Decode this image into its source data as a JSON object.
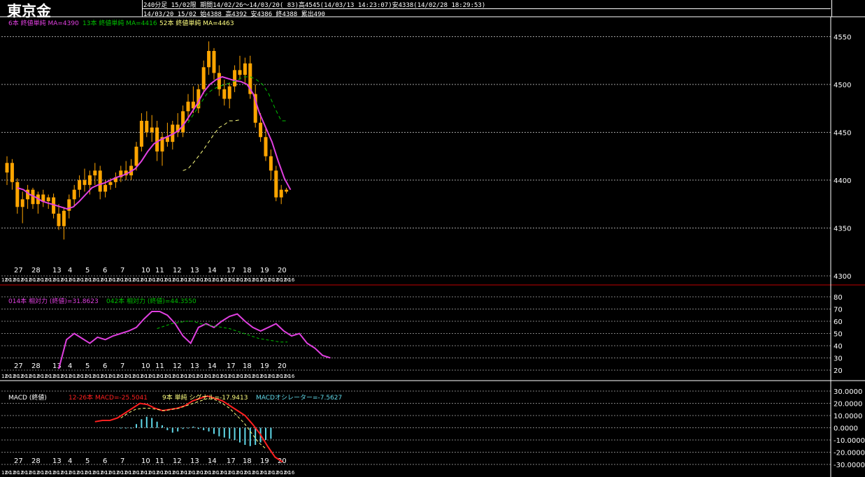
{
  "header": {
    "title": "東京金",
    "row1_a": "240分足 15/02限",
    "row1_b": "期間14/02/26〜14/03/20( 83)高4545(14/03/13 14:23:07)安4338(14/02/28 18:29:53)",
    "row2": "14/03/20 15/02 始4388 高4392 安4386 終4388 累出490"
  },
  "colors": {
    "background": "#000000",
    "candle": "#ffa500",
    "ma6": "#e040e0",
    "ma13": "#00c000",
    "ma52": "#ffff80",
    "rsi14": "#e040e0",
    "rsi42": "#00c000",
    "macd": "#ff2020",
    "signal": "#ffff80",
    "osc": "#60d8e8",
    "divider": "#c00000",
    "grid": "#ffffff"
  },
  "x_date_labels": [
    "27",
    "28",
    "13",
    "4",
    "5",
    "6",
    "7",
    "10",
    "11",
    "12",
    "13",
    "14",
    "17",
    "18",
    "19",
    "20"
  ],
  "x_time_labels": [
    "12",
    "00",
    "12",
    "00",
    "12",
    "00",
    "12",
    "00",
    "12",
    "00",
    "12",
    "00",
    "12",
    "00",
    "12",
    "00",
    "12",
    "00",
    "12",
    "00",
    "12",
    "00",
    "12",
    "00",
    "12",
    "00",
    "12",
    "00",
    "12",
    "00",
    "12",
    "00",
    "12",
    "00",
    "12",
    "00",
    "12",
    "00",
    "12",
    "00",
    "12",
    "00",
    "12",
    "00",
    "12",
    "00",
    "12",
    "00",
    "12",
    "00",
    "12",
    "00",
    "12",
    "00",
    "12",
    "00",
    "12",
    "00",
    "12",
    "00",
    "12",
    "00",
    "12",
    "00",
    "12",
    "00",
    "12",
    "00",
    "12",
    "00",
    "12",
    "00",
    "16"
  ],
  "chart_data": [
    {
      "type": "candlestick",
      "panel": "price",
      "legend": {
        "ma6": "6本 終値単純 MA=4390",
        "ma13": "13本 終値単純 MA=4416",
        "ma52": "52本 終値単純 MA=4463"
      },
      "ylim": [
        4300,
        4570
      ],
      "yticks": [
        4300,
        4350,
        4400,
        4450,
        4500,
        4550
      ],
      "ohlc": [
        [
          4408,
          4425,
          4395,
          4418
        ],
        [
          4418,
          4422,
          4390,
          4398
        ],
        [
          4398,
          4402,
          4365,
          4372
        ],
        [
          4372,
          4388,
          4355,
          4380
        ],
        [
          4380,
          4395,
          4370,
          4390
        ],
        [
          4390,
          4392,
          4370,
          4375
        ],
        [
          4375,
          4388,
          4365,
          4385
        ],
        [
          4385,
          4390,
          4372,
          4378
        ],
        [
          4378,
          4385,
          4370,
          4382
        ],
        [
          4382,
          4386,
          4360,
          4365
        ],
        [
          4365,
          4375,
          4348,
          4352
        ],
        [
          4352,
          4372,
          4338,
          4368
        ],
        [
          4368,
          4385,
          4360,
          4380
        ],
        [
          4380,
          4395,
          4372,
          4390
        ],
        [
          4390,
          4405,
          4382,
          4400
        ],
        [
          4400,
          4412,
          4388,
          4395
        ],
        [
          4395,
          4410,
          4385,
          4405
        ],
        [
          4405,
          4418,
          4395,
          4410
        ],
        [
          4410,
          4415,
          4380,
          4388
        ],
        [
          4388,
          4400,
          4382,
          4395
        ],
        [
          4395,
          4402,
          4390,
          4398
        ],
        [
          4398,
          4408,
          4392,
          4403
        ],
        [
          4403,
          4415,
          4398,
          4410
        ],
        [
          4410,
          4420,
          4400,
          4405
        ],
        [
          4405,
          4422,
          4400,
          4415
        ],
        [
          4415,
          4440,
          4410,
          4435
        ],
        [
          4435,
          4470,
          4430,
          4462
        ],
        [
          4462,
          4472,
          4445,
          4450
        ],
        [
          4450,
          4468,
          4440,
          4455
        ],
        [
          4455,
          4462,
          4420,
          4430
        ],
        [
          4430,
          4450,
          4415,
          4445
        ],
        [
          4445,
          4460,
          4435,
          4440
        ],
        [
          4440,
          4462,
          4432,
          4458
        ],
        [
          4458,
          4470,
          4445,
          4450
        ],
        [
          4450,
          4478,
          4445,
          4472
        ],
        [
          4472,
          4490,
          4462,
          4482
        ],
        [
          4482,
          4498,
          4470,
          4475
        ],
        [
          4475,
          4500,
          4470,
          4495
        ],
        [
          4495,
          4525,
          4490,
          4518
        ],
        [
          4518,
          4545,
          4510,
          4535
        ],
        [
          4535,
          4538,
          4505,
          4512
        ],
        [
          4512,
          4520,
          4488,
          4495
        ],
        [
          4495,
          4505,
          4478,
          4485
        ],
        [
          4485,
          4502,
          4475,
          4498
        ],
        [
          4498,
          4520,
          4492,
          4515
        ],
        [
          4515,
          4530,
          4505,
          4510
        ],
        [
          4510,
          4528,
          4500,
          4522
        ],
        [
          4522,
          4530,
          4485,
          4490
        ],
        [
          4490,
          4500,
          4455,
          4460
        ],
        [
          4460,
          4470,
          4440,
          4445
        ],
        [
          4445,
          4455,
          4420,
          4425
        ],
        [
          4425,
          4432,
          4400,
          4410
        ],
        [
          4410,
          4415,
          4378,
          4382
        ],
        [
          4382,
          4395,
          4375,
          4390
        ],
        [
          4390,
          4392,
          4386,
          4388
        ]
      ],
      "ma6": [
        4392,
        4390,
        4385,
        4382,
        4378,
        4376,
        4374,
        4372,
        4370,
        4372,
        4378,
        4385,
        4392,
        4395,
        4397,
        4400,
        4403,
        4405,
        4408,
        4412,
        4420,
        4430,
        4438,
        4442,
        4445,
        4448,
        4452,
        4460,
        4470,
        4480,
        4492,
        4500,
        4505,
        4508,
        4506,
        4504,
        4503,
        4500,
        4490,
        4470,
        4455,
        4440,
        4420,
        4402,
        4390
      ],
      "ma13": [
        4460,
        4470,
        4480,
        4490,
        4495,
        4498,
        4500,
        4502,
        4505,
        4508,
        4508,
        4505,
        4500,
        4490,
        4475,
        4462,
        4462
      ],
      "ma52": [
        4410,
        4412,
        4418,
        4425,
        4432,
        4440,
        4448,
        4455,
        4458,
        4462,
        4462,
        4463
      ]
    },
    {
      "type": "line",
      "panel": "rsi",
      "legend": {
        "rsi14": "014本 相対力 (終値)=31.8623",
        "rsi42": "042本 相対力 (終値)=44.3550"
      },
      "ylim": [
        20,
        80
      ],
      "yticks": [
        20,
        30,
        40,
        50,
        60,
        70,
        80
      ],
      "rsi14": [
        21,
        45,
        50,
        46,
        42,
        47,
        45,
        48,
        50,
        52,
        55,
        62,
        68,
        68,
        65,
        58,
        48,
        42,
        55,
        58,
        55,
        60,
        64,
        66,
        60,
        55,
        52,
        55,
        58,
        52,
        48,
        50,
        42,
        38,
        32,
        30
      ],
      "rsi42": [
        54,
        56,
        58,
        59,
        60,
        60,
        58,
        57,
        56,
        55,
        54,
        52,
        50,
        48,
        46,
        45,
        44,
        43,
        43
      ]
    },
    {
      "type": "line",
      "panel": "macd",
      "legend": {
        "macd_label": "MACD (終値)",
        "macd": "12-26本 MACD=-25.5041",
        "signal": "9本 単純 シグナル=-17.9413",
        "osc": "MACDオシレーター=-7.5627"
      },
      "ylim": [
        -30,
        30
      ],
      "yticks": [
        "30.0000",
        "20.0000",
        "10.0000",
        "0.0000",
        "-10.0000",
        "-20.0000",
        "-30.0000"
      ],
      "macd": [
        5,
        6,
        6,
        8,
        12,
        16,
        20,
        19,
        16,
        14,
        15,
        16,
        18,
        22,
        24,
        26,
        24,
        22,
        18,
        14,
        10,
        3,
        -5,
        -15,
        -24,
        -28
      ],
      "signal": [
        8,
        12,
        15,
        16,
        16,
        15,
        14,
        15,
        16,
        18,
        20,
        22,
        24,
        23,
        20,
        16,
        10,
        4,
        -4,
        -12,
        -17
      ],
      "osc": [
        0,
        0,
        0,
        3,
        7,
        9,
        8,
        5,
        2,
        -2,
        -4,
        -3,
        -1,
        0,
        1,
        -1,
        -2,
        -3,
        -5,
        -7,
        -8,
        -9,
        -10,
        -12,
        -14,
        -15,
        -14,
        -12,
        -10,
        -9
      ]
    }
  ]
}
